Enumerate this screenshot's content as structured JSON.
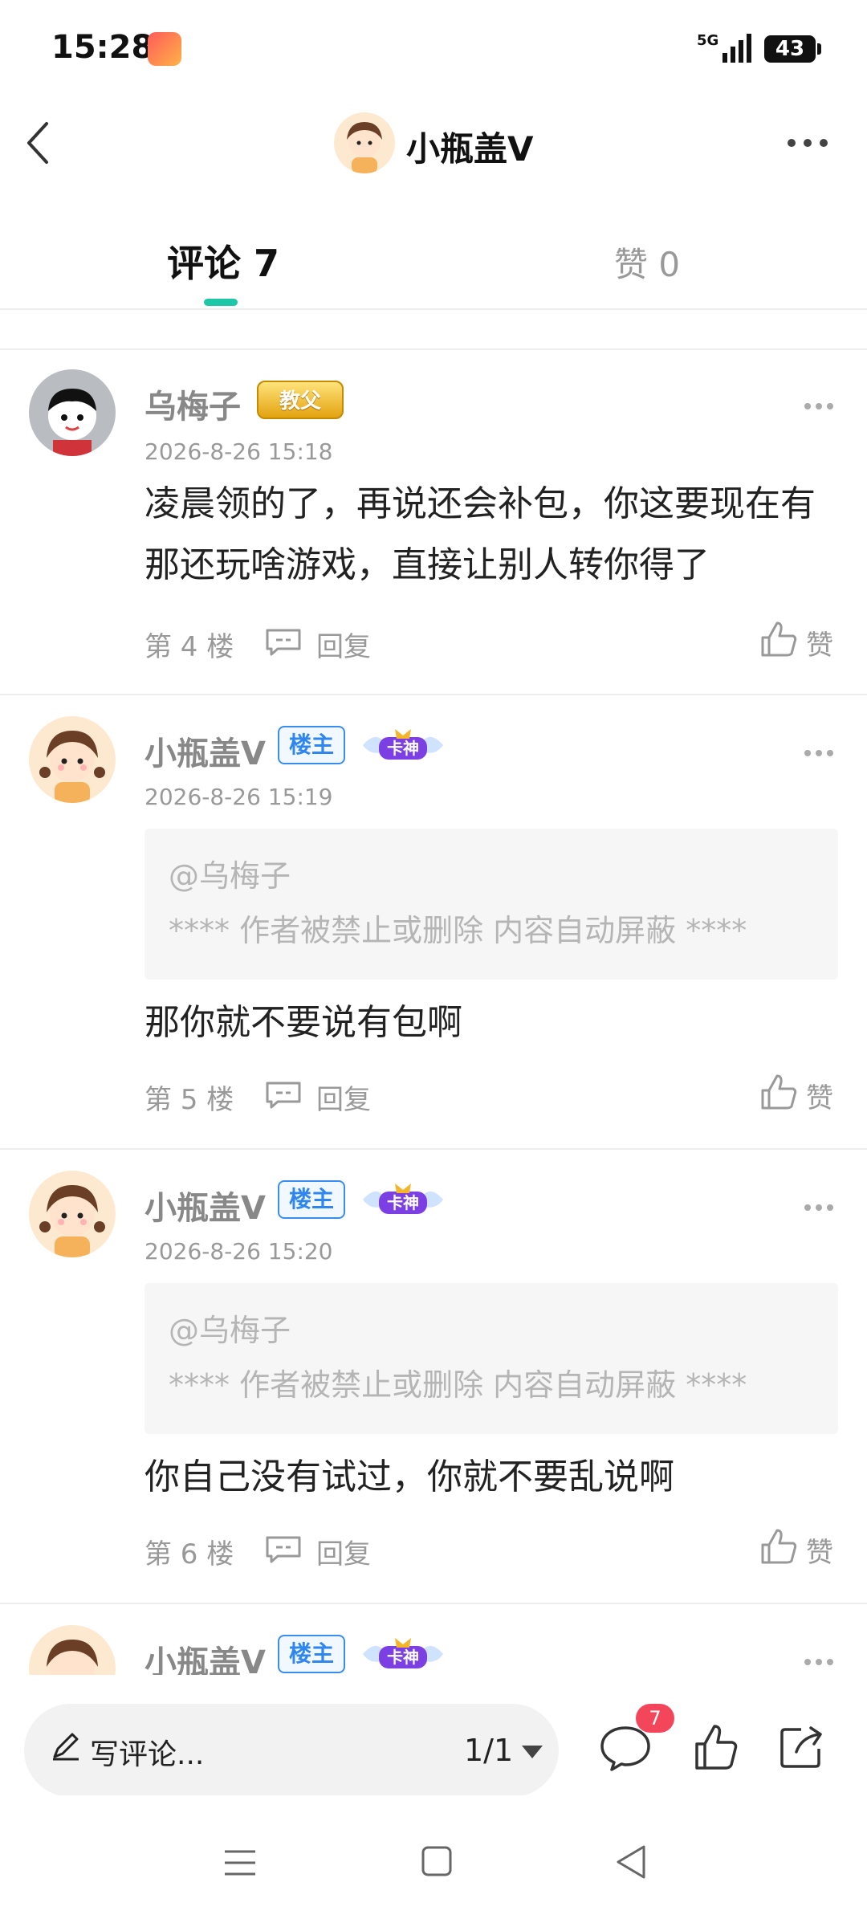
{
  "status_bar": {
    "time": "15:28",
    "network": "5G",
    "battery": "43"
  },
  "header": {
    "title": "小瓶盖V"
  },
  "tabs": {
    "comments_label": "评论 7",
    "likes_label": "赞 0"
  },
  "comments": [
    {
      "username": "乌梅子",
      "badge": "教父",
      "date": "2026-8-26 15:18",
      "content": "凌晨领的了，再说还会补包，你这要现在有那还玩啥游戏，直接让别人转你得了",
      "floor": "第 4 楼",
      "reply_label": "回复",
      "like_label": "赞"
    },
    {
      "username": "小瓶盖V",
      "owner_badge": "楼主",
      "card_badge": "卡神",
      "date": "2026-8-26 15:19",
      "quote_at": "@乌梅子",
      "quote_text": "**** 作者被禁止或删除 内容自动屏蔽 ****",
      "content": "那你就不要说有包啊",
      "floor": "第 5 楼",
      "reply_label": "回复",
      "like_label": "赞"
    },
    {
      "username": "小瓶盖V",
      "owner_badge": "楼主",
      "card_badge": "卡神",
      "date": "2026-8-26 15:20",
      "quote_at": "@乌梅子",
      "quote_text": "**** 作者被禁止或删除 内容自动屏蔽 ****",
      "content": "你自己没有试过，你就不要乱说啊",
      "floor": "第 6 楼",
      "reply_label": "回复",
      "like_label": "赞"
    },
    {
      "username": "小瓶盖V",
      "owner_badge": "楼主",
      "card_badge": "卡神"
    }
  ],
  "bottom_bar": {
    "write_placeholder": "写评论...",
    "page_indicator": "1/1",
    "comment_count": "7"
  },
  "icons": {
    "back": "chevron-left-icon",
    "more": "more-horizontal-icon",
    "reply": "comment-bubble-icon",
    "like": "thumb-up-icon",
    "share": "share-icon",
    "pen": "pen-icon"
  },
  "colors": {
    "accent": "#1ec7a8",
    "owner_badge": "#2f86ee",
    "count_badge": "#f4465a",
    "muted_text": "#999999"
  }
}
